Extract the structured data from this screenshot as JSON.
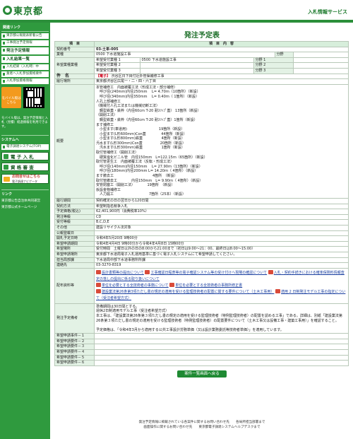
{
  "header": {
    "logo_text": "東京都",
    "service_name": "入札情報サービス"
  },
  "sidebar": {
    "heading": "関連リンク",
    "items": [
      "東京都公報発表新着公告",
      "工事発注予定情報",
      "発注予定情報",
      "入札結果一覧",
      "入札結果（入札時）中",
      "業者ヘ入札参加資格要件",
      "入札参加資格情報"
    ],
    "mobile_label": "モバイル版はこちら",
    "mobile_note": "モバイル版は、発注予定情報と入札（見積）経過情報を利用できます。",
    "system_heading": "システムへ",
    "system_link": "電子調達システム(TOP)",
    "btn_denshi": "電 子 入 札",
    "btn_shikaku": "資 格 審 査",
    "inquiry_title": "お問合せはこちら",
    "inquiry_sub": "電子調達ナビゲータ",
    "links_heading": "リンク",
    "links": [
      "東京都公告自治体共同運営",
      "東京都公式ホームページ"
    ]
  },
  "page": {
    "title": "発注予定表",
    "col_item": "項　目",
    "col_content": "項　目　内　容"
  },
  "rows": {
    "contract_no_label": "契約番号",
    "contract_no": "03-土単-005",
    "category_label": "業種",
    "category": "0500 下水道施設工事",
    "desired_label": "希望業種業種",
    "desired": [
      "希望受付業種 1",
      "希望受付業種 2",
      "希望受付業種 3"
    ],
    "desired_first_value": "0500 下水道施設工事",
    "sub_labels": [
      "分野",
      "分野 1",
      "分野 2",
      "分野 3"
    ],
    "subject_label": "件　名",
    "subject_tag": "【電子】",
    "subject": "渋谷区日下目付近外管渠補修工事",
    "location_label": "履行場所",
    "location": "東京都渋谷区広尾一・二・四・六丁目",
    "summary_label": "概要",
    "summary": "本管補修工　内面被覆工法（形成工法・部分補修）\n　呼び径(240mm)内径250mm　 L= 4.70ｍ（10箇所）（新設）\n　呼び径(340mm)内径350mm　 L= 0.40ｍ（ 1箇所）（新設）\n人孔上部補修工\n（機械付人孔工法または機械切断工法）\n　鋼型鉄蓋・鉄枠（内径60cm T-20 耐ｽﾘｯﾌﾟ蓋） 13箇所（新設）\n（開削工法）\n　鋼型鉄蓋・鉄枠（内径60cm T-20 耐ｽﾘｯﾌﾟ蓋）1箇所（新設）\nます補修工\n　小型ます(車道用)　　　　　　　　　19箇所（新設）\n　小型ます(L形600mm)Con蓋　　　　 44箇所（新設）\n　小型ます(L形800mm)鉄蓋　　　　　 4箇所（新設）\n汚水ます(L形300mm)Con蓋　　　　　20箇所（新設）\n　汚水ます(L形300mm)鉄蓋　　　　　 1箇所（新設）\n取付管補修工（開削工法）\n　硬質塩化ビニル管　内径150mm　L=122.15ｍ（65箇所）（新設）\n取付管更生工　内面被覆工法（反転・形成工法）\n　呼び径(140mm)内径150mm　 L= 27.90ｍ（13箇所）（新設）\n　呼び径(180mm)内径200mm L= 14.20ｍ（ 4箇所）（新設）\nます撤去工　　　　　　　　　　　4箇所　（新設）\n取付管撤去工　　　　内径150mm　L= 9.90ｍ（ 4箇所）（新設）\n安管閉塞工（開削工法）　　　　19箇所　（新設）\n仮設金物補修工\n　人力掘工　　　　　　　　　　7箇所（25本）（新設）",
    "period_label": "履行期間",
    "period": "契約確定の日の翌日から120日間",
    "method_label": "契約方法",
    "method": "希望制指名競争入札",
    "price_label": "予定価格(税込)",
    "price": "62,401,900円（消費税率10%）",
    "grade_label": "発注等級",
    "grade": "CD",
    "target_label": "受付等級",
    "target": "B,C,D,E",
    "other_label": "その他",
    "other": "建設リサイクル法対象",
    "pub_label": "公報登載日",
    "pub": "",
    "open_label": "開札予定日時",
    "open": "令和4年5月20日 9時00分",
    "apply_period_label": "希望申請期間",
    "apply_period": "令和4年4月4日 9時00分から令和4年4月8日 15時00分",
    "apply_method_label": "希望場所",
    "apply_method": "受付時間　土曜日以外の日の8:00から21:00まで（初日は9:00～21：00、最終日は8:00～15:00）",
    "apply_place_label": "希望申請場所",
    "apply_place": "東京都下水道局電子入札運用基準に基づく電子入札システムにて希望申請してください。",
    "dept_label": "担当局部課",
    "dept": "下水道局中部下水道事務所所課",
    "contact_label": "連絡先",
    "contact": "03-3270-8319",
    "docs_label": "配布資料等",
    "docs": [
      "設計書類等の提出について",
      "工事確認日程表等の電子確認システム等の受け付けへ現場の確認について",
      "入札・契約手続きにおける確率保険料情報査定の落しの提出に係る取り扱いについて",
      "単位を必要とする全技術者の事務について",
      "単位を必要とする全技術者の事務所修正書",
      "建設業法第26条第3項ただし書の規定の適用を受ける監理技術者の配置に関する要件について（土木工事用）",
      "適用 2 日制発注モデル工事の指定について（受注者希望方式）"
    ],
    "notes_label": "発注予定備考",
    "notes": "準備期間は30日間とする。\n週休2日制適用モデル工事（受注者希望方式）\n本工事は、「建設業法第26条第３項ただし書の規定の適用を受ける監理技術者（特例監理技術者）の配置を認める工事」である。詳細は、別紙「建設業法第26条第３項ただし書の規定の適用を受ける監理技術者（特例監理技術者）の配置要件について（土木工事又は設備工事・建築工事用）」を確認すること。\n\n予定価格は、「令和4年3月から適用する公共工事設計労務単価（又は設計業務委託等技術者単価）」を適用しています。",
    "req_labels": [
      "希望申請事件－１",
      "希望申請要件－２",
      "希望申請要件－３",
      "希望申請要件－４",
      "希望申請要件－５",
      "希望申請要件－６"
    ]
  },
  "back_button": "案件一覧画面へ戻る",
  "footer": {
    "line1": "発注予定情報に掲載されている各案件に関するお問い合わせ先　　各局所担当部署まで",
    "line2": "画面操作に関するお問い合わせ先　　東京都電子調達システムヘルプデスクまで"
  }
}
